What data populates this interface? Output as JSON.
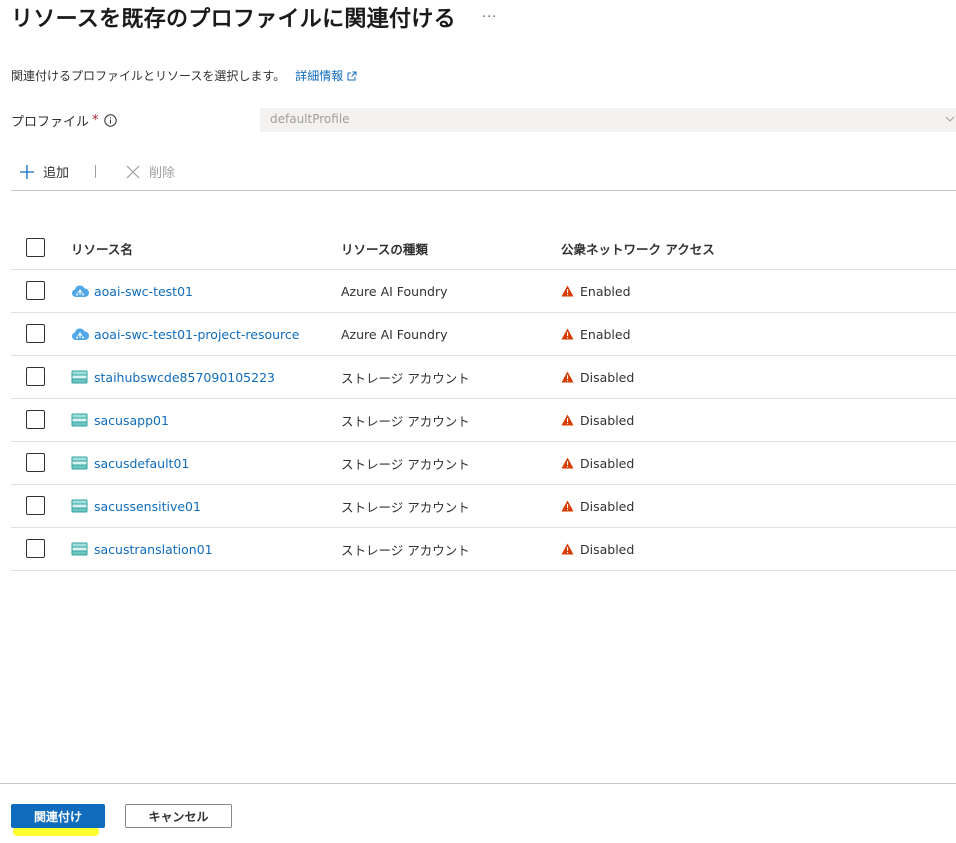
{
  "header": {
    "title": "リソースを既存のプロファイルに関連付ける",
    "more_label": "···"
  },
  "description": {
    "text": "関連付けるプロファイルとリソースを選択します。",
    "learn_more_label": "詳細情報"
  },
  "profile": {
    "label": "プロファイル",
    "required_mark": "*",
    "value": "defaultProfile"
  },
  "toolbar": {
    "add_label": "追加",
    "delete_label": "削除"
  },
  "table": {
    "columns": {
      "name": "リソース名",
      "type": "リソースの種類",
      "network": "公衆ネットワーク アクセス"
    },
    "rows": [
      {
        "name": "aoai-swc-test01",
        "type": "Azure AI Foundry",
        "network": "Enabled",
        "icon": "ai-foundry-cloud-icon"
      },
      {
        "name": "aoai-swc-test01-project-resource",
        "type": "Azure AI Foundry",
        "network": "Enabled",
        "icon": "ai-foundry-cloud-icon"
      },
      {
        "name": "staihubswcde857090105223",
        "type": "ストレージ アカウント",
        "network": "Disabled",
        "icon": "storage-account-icon"
      },
      {
        "name": "sacusapp01",
        "type": "ストレージ アカウント",
        "network": "Disabled",
        "icon": "storage-account-icon"
      },
      {
        "name": "sacusdefault01",
        "type": "ストレージ アカウント",
        "network": "Disabled",
        "icon": "storage-account-icon"
      },
      {
        "name": "sacussensitive01",
        "type": "ストレージ アカウント",
        "network": "Disabled",
        "icon": "storage-account-icon"
      },
      {
        "name": "sacustranslation01",
        "type": "ストレージ アカウント",
        "network": "Disabled",
        "icon": "storage-account-icon"
      }
    ]
  },
  "footer": {
    "associate_label": "関連付け",
    "cancel_label": "キャンセル"
  },
  "colors": {
    "link": "#0f6cbd",
    "primary_button": "#0f6cbd",
    "warning": "#d83b01",
    "highlight": "#ffff30"
  }
}
